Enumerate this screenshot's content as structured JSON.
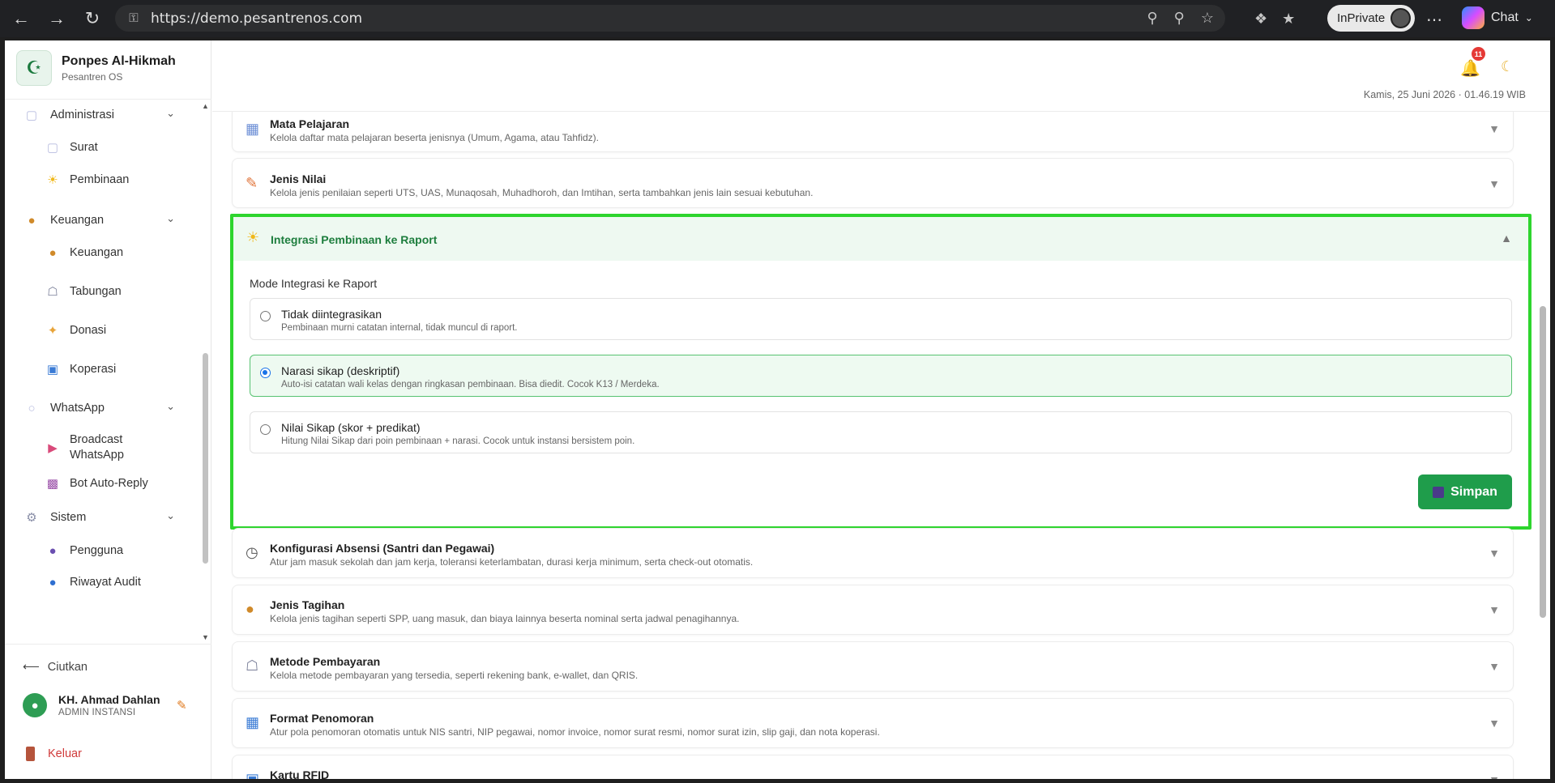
{
  "browser": {
    "url": "https://demo.pesantrenos.com",
    "inprivate_label": "InPrivate",
    "chat_label": "Chat"
  },
  "brand": {
    "name": "Ponpes Al-Hikmah",
    "subtitle": "Pesantren OS"
  },
  "sidebar": {
    "items": [
      {
        "type": "parent",
        "label": "Administrasi",
        "icon": "envelope-icon"
      },
      {
        "type": "child",
        "label": "Surat",
        "icon": "envelope-icon"
      },
      {
        "type": "child",
        "label": "Pembinaan",
        "icon": "sun-icon"
      },
      {
        "type": "parent",
        "label": "Keuangan",
        "icon": "money-bag-icon"
      },
      {
        "type": "child",
        "label": "Keuangan",
        "icon": "money-bag-icon"
      },
      {
        "type": "child",
        "label": "Tabungan",
        "icon": "bank-icon"
      },
      {
        "type": "child",
        "label": "Donasi",
        "icon": "handshake-icon"
      },
      {
        "type": "child",
        "label": "Koperasi",
        "icon": "shopping-bag-icon"
      },
      {
        "type": "parent",
        "label": "WhatsApp",
        "icon": "chat-bubble-icon"
      },
      {
        "type": "child",
        "label": "Broadcast WhatsApp",
        "icon": "megaphone-icon"
      },
      {
        "type": "child",
        "label": "Bot Auto-Reply",
        "icon": "robot-icon"
      },
      {
        "type": "parent",
        "label": "Sistem",
        "icon": "gear-icon"
      },
      {
        "type": "child",
        "label": "Pengguna",
        "icon": "users-icon"
      },
      {
        "type": "child",
        "label": "Riwayat Audit",
        "icon": "shield-icon"
      }
    ],
    "collapse_label": "Ciutkan",
    "user": {
      "name": "KH. Ahmad Dahlan",
      "role": "ADMIN INSTANSI"
    },
    "logout_label": "Keluar"
  },
  "topbar": {
    "notification_count": "11",
    "datetime": "Kamis, 25 Juni 2026 · 01.46.19 WIB"
  },
  "settings": {
    "cards_top": [
      {
        "title": "Mata Pelajaran",
        "desc": "Kelola daftar mata pelajaran beserta jenisnya (Umum, Agama, atau Tahfidz).",
        "icon": "books-icon"
      },
      {
        "title": "Jenis Nilai",
        "desc": "Kelola jenis penilaian seperti UTS, UAS, Munaqosah, Muhadhoroh, dan Imtihan, serta tambahkan jenis lain sesuai kebutuhan.",
        "icon": "memo-icon"
      }
    ],
    "active": {
      "title": "Integrasi Pembinaan ke Raport",
      "mode_label": "Mode Integrasi ke Raport",
      "options": [
        {
          "title": "Tidak diintegrasikan",
          "desc": "Pembinaan murni catatan internal, tidak muncul di raport.",
          "selected": false
        },
        {
          "title": "Narasi sikap (deskriptif)",
          "desc": "Auto-isi catatan wali kelas dengan ringkasan pembinaan. Bisa diedit. Cocok K13 / Merdeka.",
          "selected": true
        },
        {
          "title": "Nilai Sikap (skor + predikat)",
          "desc": "Hitung Nilai Sikap dari poin pembinaan + narasi. Cocok untuk instansi bersistem poin.",
          "selected": false
        }
      ],
      "save_label": "Simpan"
    },
    "cards_bottom": [
      {
        "title": "Konfigurasi Absensi (Santri dan Pegawai)",
        "desc": "Atur jam masuk sekolah dan jam kerja, toleransi keterlambatan, durasi kerja minimum, serta check-out otomatis.",
        "icon": "clock-icon"
      },
      {
        "title": "Jenis Tagihan",
        "desc": "Kelola jenis tagihan seperti SPP, uang masuk, dan biaya lainnya beserta nominal serta jadwal penagihannya.",
        "icon": "money-bag-icon"
      },
      {
        "title": "Metode Pembayaran",
        "desc": "Kelola metode pembayaran yang tersedia, seperti rekening bank, e-wallet, dan QRIS.",
        "icon": "bank-icon"
      },
      {
        "title": "Format Penomoran",
        "desc": "Atur pola penomoran otomatis untuk NIS santri, NIP pegawai, nomor invoice, nomor surat resmi, nomor surat izin, slip gaji, dan nota koperasi.",
        "icon": "numbers-icon"
      },
      {
        "title": "Kartu RFID",
        "desc": "",
        "icon": "card-icon"
      }
    ]
  }
}
